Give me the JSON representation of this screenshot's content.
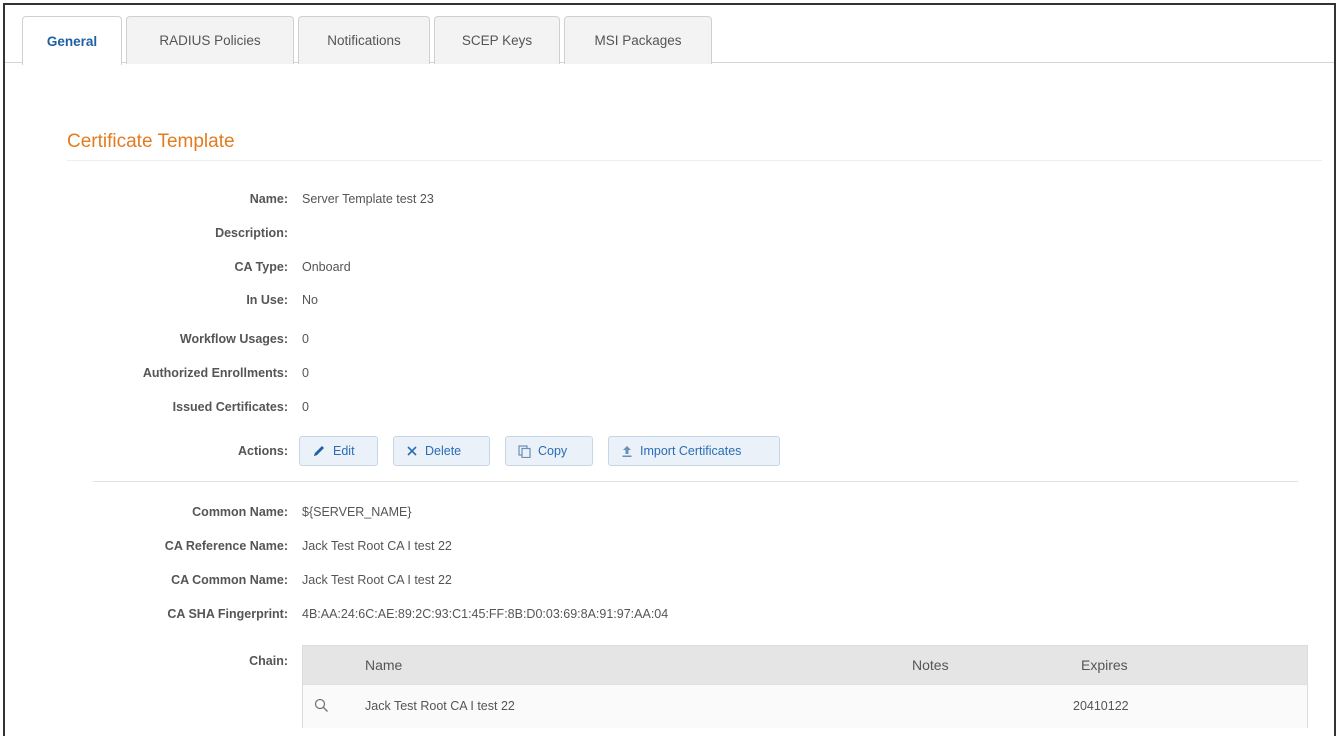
{
  "tabs": [
    {
      "label": "General",
      "active": true
    },
    {
      "label": "RADIUS Policies",
      "active": false
    },
    {
      "label": "Notifications",
      "active": false
    },
    {
      "label": "SCEP Keys",
      "active": false
    },
    {
      "label": "MSI Packages",
      "active": false
    }
  ],
  "section_title": "Certificate Template",
  "fields": {
    "name": {
      "label": "Name:",
      "value": "Server Template test 23"
    },
    "description": {
      "label": "Description:",
      "value": ""
    },
    "ca_type": {
      "label": "CA Type:",
      "value": "Onboard"
    },
    "in_use": {
      "label": "In Use:",
      "value": "No"
    },
    "workflow_usages": {
      "label": "Workflow Usages:",
      "value": "0"
    },
    "authorized_enrollments": {
      "label": "Authorized Enrollments:",
      "value": "0"
    },
    "issued_certificates": {
      "label": "Issued Certificates:",
      "value": "0"
    },
    "actions": {
      "label": "Actions:"
    },
    "common_name": {
      "label": "Common Name:",
      "value": "${SERVER_NAME}"
    },
    "ca_reference_name": {
      "label": "CA Reference Name:",
      "value": "Jack Test Root CA I test 22"
    },
    "ca_common_name": {
      "label": "CA Common Name:",
      "value": "Jack Test Root CA I test 22"
    },
    "ca_sha_fingerprint": {
      "label": "CA SHA Fingerprint:",
      "value": "4B:AA:24:6C:AE:89:2C:93:C1:45:FF:8B:D0:03:69:8A:91:97:AA:04"
    },
    "chain": {
      "label": "Chain:"
    }
  },
  "actions": {
    "edit": "Edit",
    "delete": "Delete",
    "copy": "Copy",
    "import_certificates": "Import Certificates"
  },
  "chain_table": {
    "columns": {
      "name": "Name",
      "notes": "Notes",
      "expires": "Expires"
    },
    "rows": [
      {
        "name": "Jack Test Root CA I test 22",
        "notes": "",
        "expires": "20410122"
      }
    ]
  },
  "icons": {
    "edit": "pencil-icon",
    "delete": "x-icon",
    "copy": "copy-icon",
    "import": "upload-icon",
    "view": "magnifier-icon"
  },
  "colors": {
    "accent_orange": "#e47b1e",
    "active_tab_blue": "#1f5fa3",
    "button_text_blue": "#2a6cb5",
    "button_bg": "#eaf1f8"
  }
}
